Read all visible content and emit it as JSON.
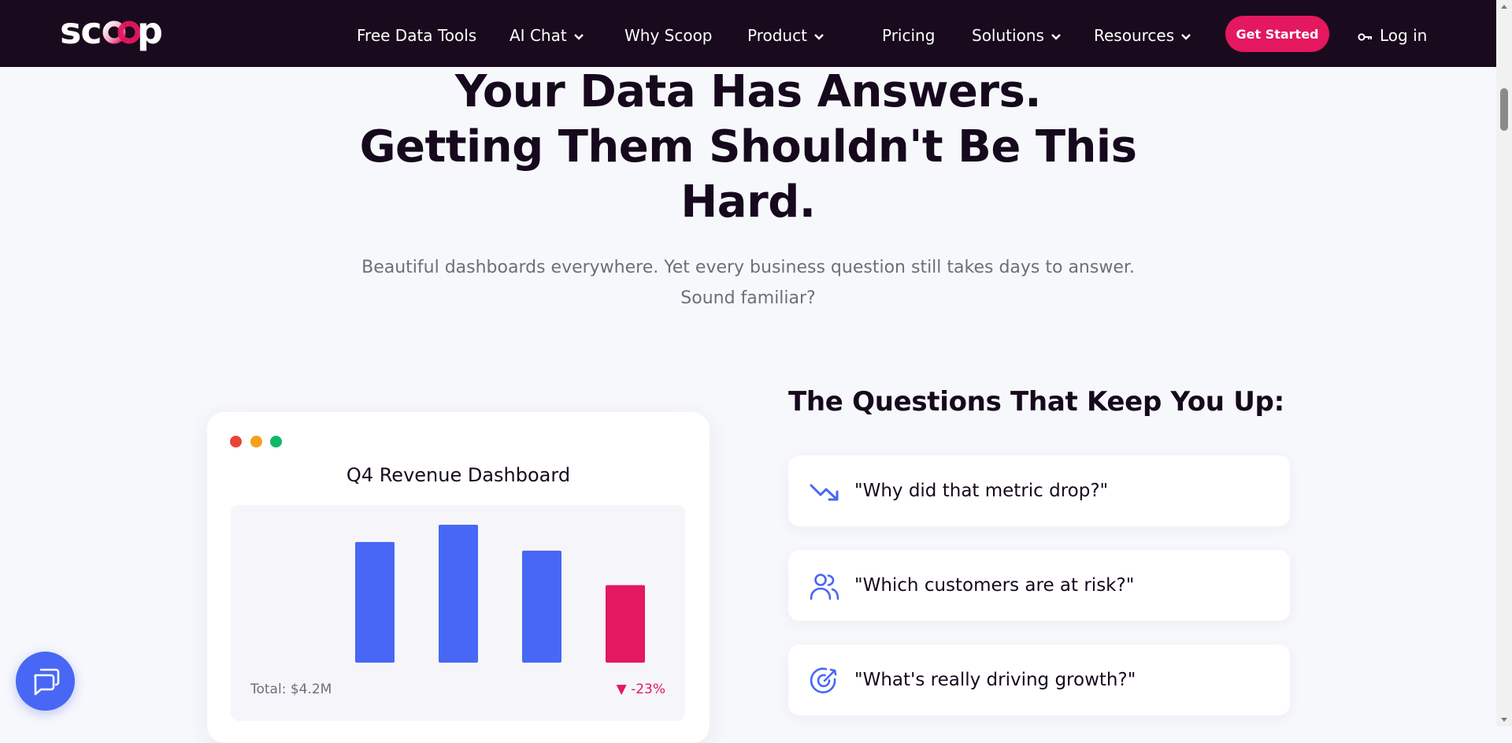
{
  "nav": {
    "logo": "scoop",
    "items": [
      {
        "label": "Free Data Tools",
        "has_dropdown": false
      },
      {
        "label": "AI Chat",
        "has_dropdown": true
      },
      {
        "label": "Why Scoop",
        "has_dropdown": false
      },
      {
        "label": "Product",
        "has_dropdown": true
      },
      {
        "label": "Pricing",
        "has_dropdown": false
      },
      {
        "label": "Solutions",
        "has_dropdown": true
      },
      {
        "label": "Resources",
        "has_dropdown": true
      }
    ],
    "cta_label": "Get Started",
    "login_label": "Log in"
  },
  "hero": {
    "title_line1": "Your Data Has Answers.",
    "title_line2": "Getting Them Shouldn't Be This",
    "title_line3": "Hard.",
    "subtitle": "Beautiful dashboards everywhere. Yet every business question still takes days to answer. Sound familiar?"
  },
  "dashboard": {
    "title": "Q4 Revenue Dashboard",
    "total": "Total: $4.2M",
    "change": "▼ -23%"
  },
  "chart_data": {
    "type": "bar",
    "categories": [
      "",
      "",
      "",
      ""
    ],
    "values": [
      14,
      16,
      13,
      9
    ],
    "colors": [
      "#4867f5",
      "#4867f5",
      "#4867f5",
      "#e3185e"
    ],
    "title": "Q4 Revenue Dashboard",
    "xlabel": "",
    "ylabel": "",
    "grid": false
  },
  "questions": {
    "heading": "The Questions That Keep You Up:",
    "items": [
      {
        "text": "\"Why did that metric drop?\"",
        "icon": "trend-down-icon"
      },
      {
        "text": "\"Which customers are at risk?\"",
        "icon": "users-icon"
      },
      {
        "text": "\"What's really driving growth?\"",
        "icon": "target-icon"
      }
    ]
  },
  "colors": {
    "nav_bg": "#1a0a1d",
    "accent_pink": "#e3185e",
    "accent_blue": "#4867f5",
    "page_bg": "#f7f8fc"
  }
}
